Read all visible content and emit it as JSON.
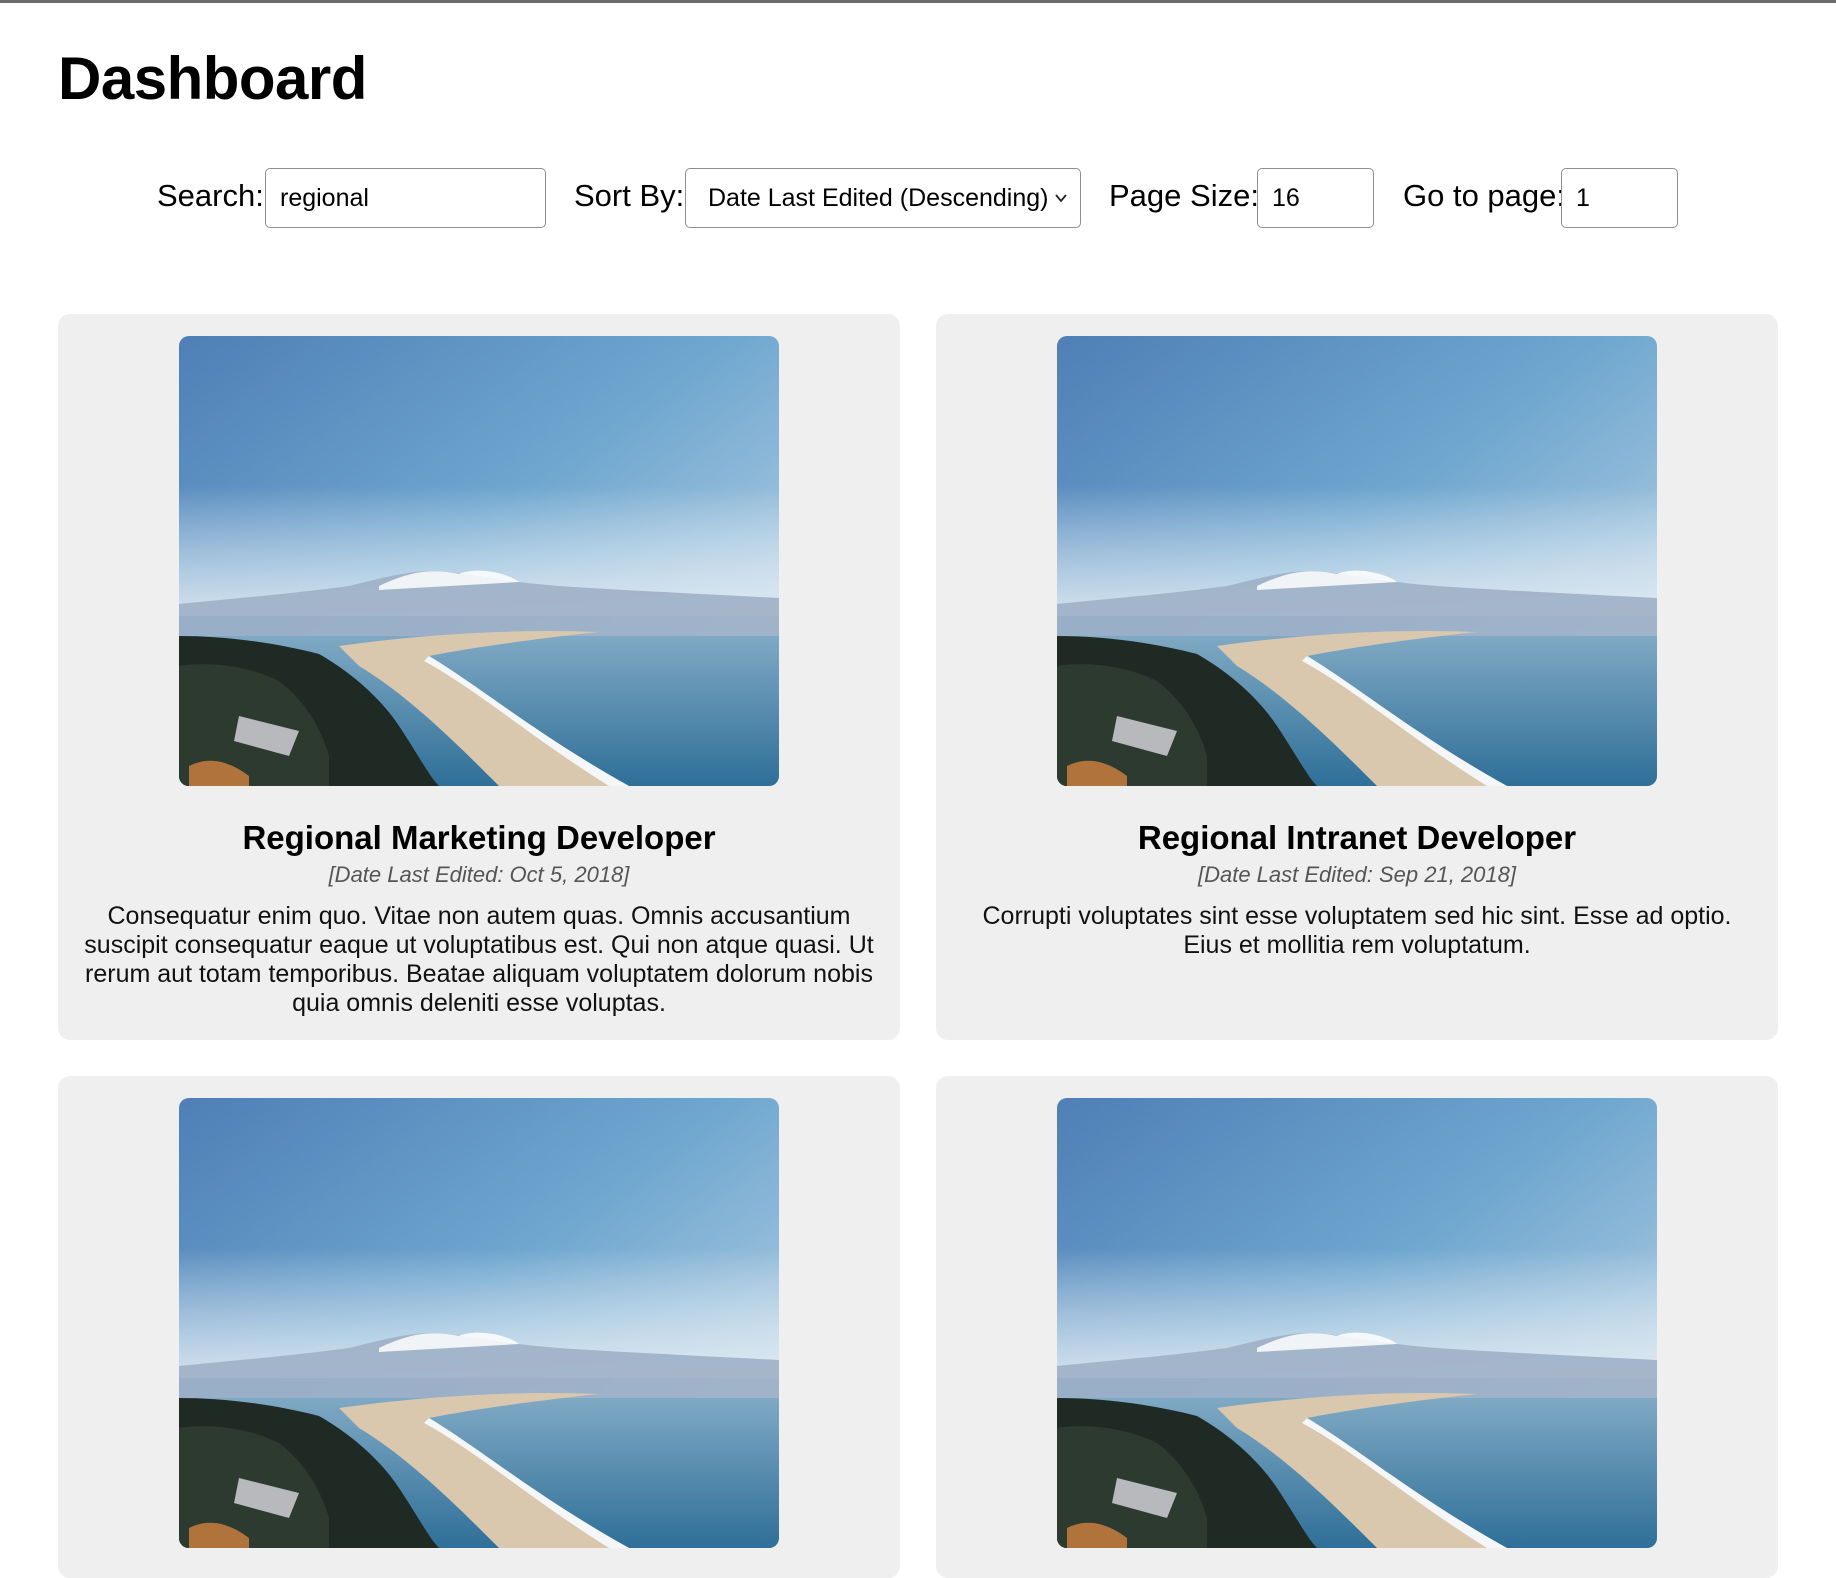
{
  "header": {
    "title": "Dashboard"
  },
  "controls": {
    "search_label": "Search:",
    "search_value": "regional",
    "sort_label": "Sort By:",
    "sort_value": "Date Last Edited (Descending)",
    "page_size_label": "Page Size:",
    "page_size_value": "16",
    "goto_label": "Go to page:",
    "goto_value": "1"
  },
  "cards": [
    {
      "title": "Regional Marketing Developer",
      "date": "[Date Last Edited: Oct 5, 2018]",
      "description": "Consequatur enim quo. Vitae non autem quas. Omnis accusantium suscipit consequatur eaque ut voluptatibus est. Qui non atque quasi. Ut rerum aut totam temporibus. Beatae aliquam voluptatem dolorum nobis quia omnis deleniti esse voluptas."
    },
    {
      "title": "Regional Intranet Developer",
      "date": "[Date Last Edited: Sep 21, 2018]",
      "description": "Corrupti voluptates sint esse voluptatem sed hic sint. Esse ad optio. Eius et mollitia rem voluptatum."
    },
    {
      "title": "",
      "date": "",
      "description": ""
    },
    {
      "title": "",
      "date": "",
      "description": ""
    }
  ],
  "colors": {
    "card_background": "#efefef",
    "sky_top": "#4f82b8",
    "ocean": "#3f7fa6"
  },
  "icons": {
    "select_arrow": "chevron-down-icon",
    "card_image": "coastline-photo"
  }
}
